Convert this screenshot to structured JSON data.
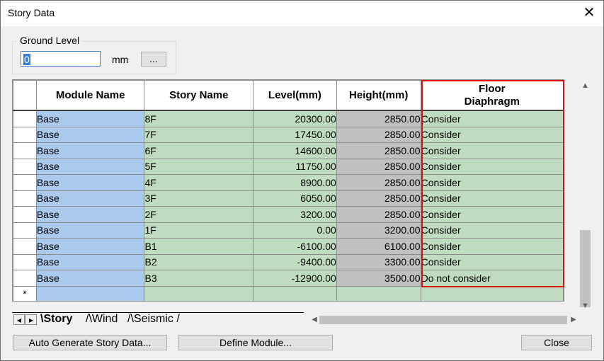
{
  "window": {
    "title": "Story Data",
    "close_glyph": "✕"
  },
  "ground_level": {
    "label": "Ground Level",
    "value": "0",
    "unit": "mm",
    "browse_label": "..."
  },
  "table": {
    "headers": {
      "module": "Module Name",
      "story": "Story Name",
      "level": "Level(mm)",
      "height": "Height(mm)",
      "floor_line1": "Floor",
      "floor_line2": "Diaphragm"
    },
    "rows": [
      {
        "module": "Base",
        "story": "8F",
        "level": "20300.00",
        "height": "2850.00",
        "floor": "Consider"
      },
      {
        "module": "Base",
        "story": "7F",
        "level": "17450.00",
        "height": "2850.00",
        "floor": "Consider"
      },
      {
        "module": "Base",
        "story": "6F",
        "level": "14600.00",
        "height": "2850.00",
        "floor": "Consider"
      },
      {
        "module": "Base",
        "story": "5F",
        "level": "11750.00",
        "height": "2850.00",
        "floor": "Consider"
      },
      {
        "module": "Base",
        "story": "4F",
        "level": "8900.00",
        "height": "2850.00",
        "floor": "Consider"
      },
      {
        "module": "Base",
        "story": "3F",
        "level": "6050.00",
        "height": "2850.00",
        "floor": "Consider"
      },
      {
        "module": "Base",
        "story": "2F",
        "level": "3200.00",
        "height": "2850.00",
        "floor": "Consider"
      },
      {
        "module": "Base",
        "story": "1F",
        "level": "0.00",
        "height": "3200.00",
        "floor": "Consider"
      },
      {
        "module": "Base",
        "story": "B1",
        "level": "-6100.00",
        "height": "6100.00",
        "floor": "Consider"
      },
      {
        "module": "Base",
        "story": "B2",
        "level": "-9400.00",
        "height": "3300.00",
        "floor": "Consider"
      },
      {
        "module": "Base",
        "story": "B3",
        "level": "-12900.00",
        "height": "3500.00",
        "floor": "Do not consider"
      }
    ],
    "new_row_marker": "*"
  },
  "tabs": [
    {
      "label": "Story"
    },
    {
      "label": "Wind"
    },
    {
      "label": "Seismic"
    }
  ],
  "buttons": {
    "auto_generate": "Auto Generate Story Data...",
    "define_module": "Define Module...",
    "close": "Close"
  },
  "colors": {
    "module_cell": "#a9c9ed",
    "editable_cell": "#c0dcc0",
    "readonly_cell": "#c0c0c0",
    "highlight": "#e01010"
  }
}
